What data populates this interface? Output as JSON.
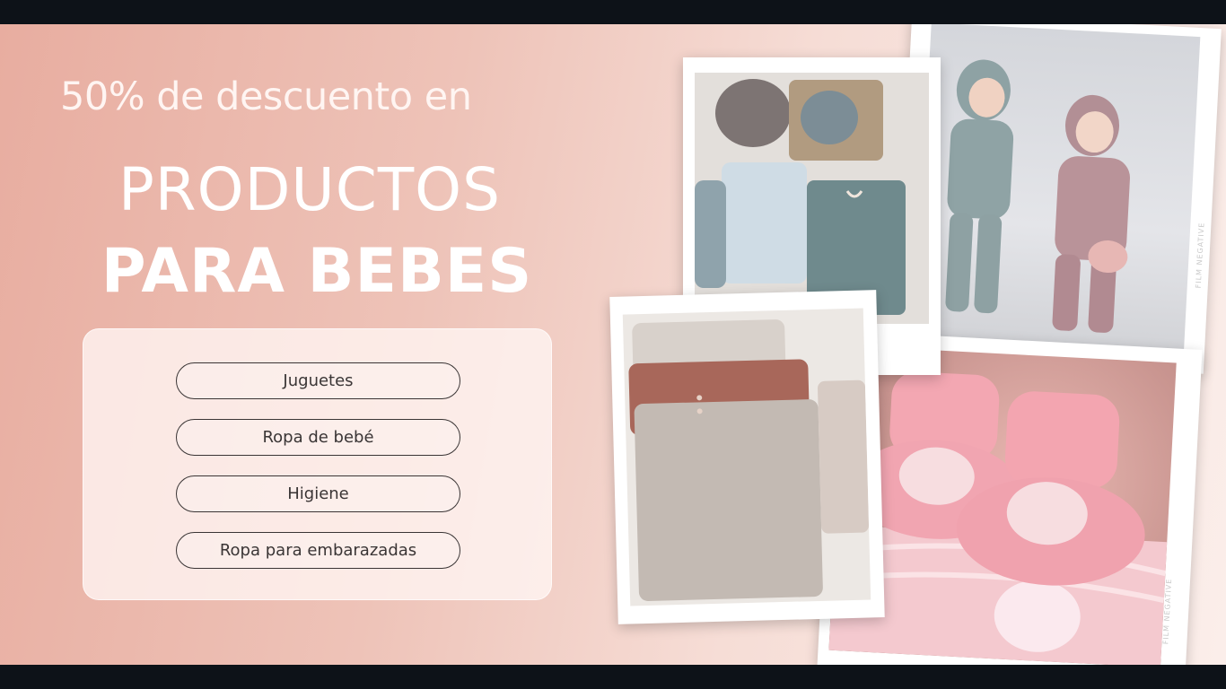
{
  "headline": {
    "line1": "50% de descuento en",
    "line2": "PRODUCTOS",
    "line3": "PARA BEBES"
  },
  "categories": [
    {
      "label": "Juguetes"
    },
    {
      "label": "Ropa de bebé"
    },
    {
      "label": "Higiene"
    },
    {
      "label": "Ropa para embarazadas"
    }
  ],
  "film_labels": {
    "label_1": "FILM NEGATIVE",
    "label_2": "FILM NEGATIVE"
  },
  "colors": {
    "background_start": "#e8ada0",
    "background_end": "#fbeeea",
    "pill_border": "#3a3535",
    "headline": "#ffffff"
  }
}
